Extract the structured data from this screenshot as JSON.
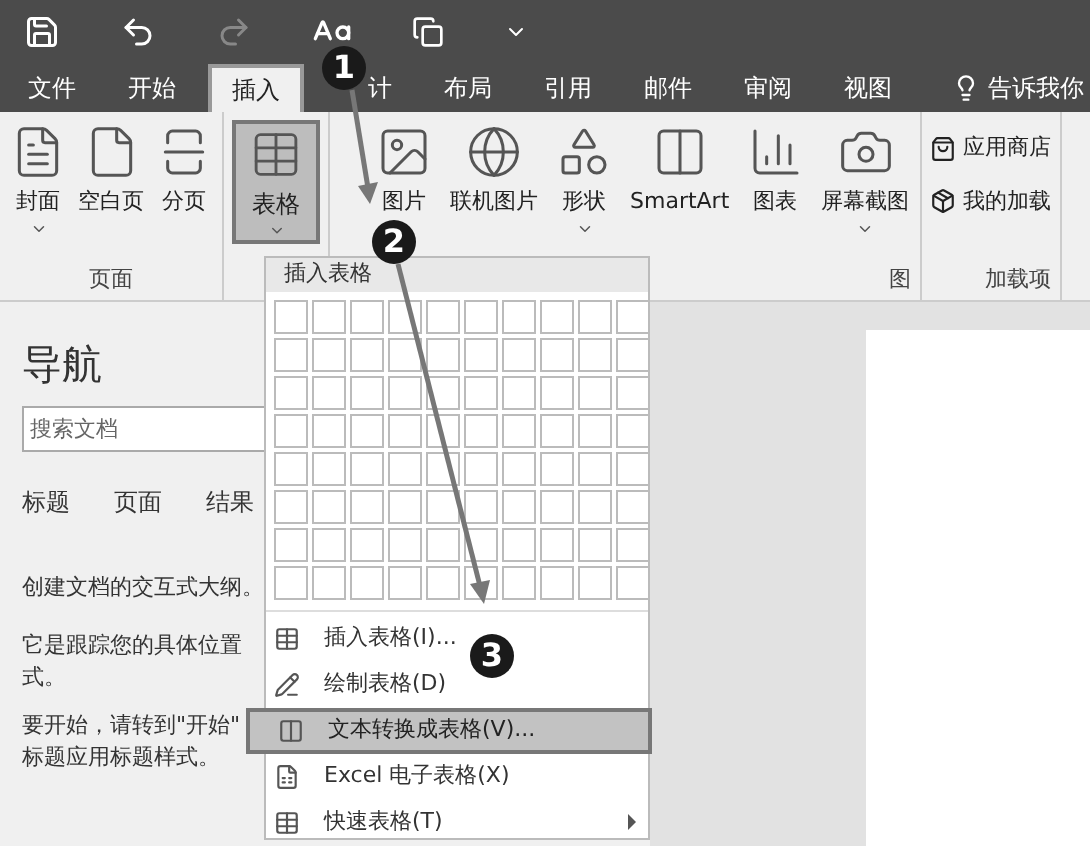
{
  "tabs": [
    {
      "label": "文件",
      "selected": false
    },
    {
      "label": "开始",
      "selected": false
    },
    {
      "label": "插入",
      "selected": true
    },
    {
      "label": "计",
      "selected": false
    },
    {
      "label": "布局",
      "selected": false
    },
    {
      "label": "引用",
      "selected": false
    },
    {
      "label": "邮件",
      "selected": false
    },
    {
      "label": "审阅",
      "selected": false
    },
    {
      "label": "视图",
      "selected": false
    }
  ],
  "tell_me": "告诉我你",
  "ribbon": {
    "groups": [
      {
        "label": "页面",
        "buttons": [
          {
            "label": "封面",
            "dropdown": true,
            "pressed": false
          },
          {
            "label": "空白页",
            "dropdown": false,
            "pressed": false
          },
          {
            "label": "分页",
            "dropdown": false,
            "pressed": false
          }
        ]
      },
      {
        "buttons": [
          {
            "label": "表格",
            "dropdown": true,
            "pressed": true
          }
        ]
      },
      {
        "label": "图",
        "buttons": [
          {
            "label": "图片",
            "dropdown": false,
            "pressed": false
          },
          {
            "label": "联机图片",
            "dropdown": false,
            "pressed": false
          },
          {
            "label": "形状",
            "dropdown": true,
            "pressed": false
          },
          {
            "label": "SmartArt",
            "dropdown": false,
            "pressed": false
          },
          {
            "label": "图表",
            "dropdown": false,
            "pressed": false
          },
          {
            "label": "屏幕截图",
            "dropdown": true,
            "pressed": false
          }
        ]
      },
      {
        "label": "加载项",
        "small_buttons": [
          "应用商店",
          "我的加载"
        ]
      }
    ]
  },
  "navigation": {
    "title": "导航",
    "search": {
      "placeholder": "搜索文档"
    },
    "tabs": [
      "标题",
      "页面",
      "结果"
    ],
    "paragraphs": [
      "创建文档的交互式大纲。",
      "它是跟踪您的具体位置",
      "式。",
      "要开始，请转到\"开始\"",
      "标题应用标题样式。"
    ]
  },
  "menu": {
    "title": "插入表格",
    "items": [
      {
        "label": "插入表格(I)...",
        "selected": false,
        "submenu": false
      },
      {
        "label": "绘制表格(D)",
        "selected": false,
        "submenu": false
      },
      {
        "label": "文本转换成表格(V)...",
        "selected": true,
        "submenu": false
      },
      {
        "label": "Excel 电子表格(X)",
        "selected": false,
        "submenu": false
      },
      {
        "label": "快速表格(T)",
        "selected": false,
        "submenu": true
      }
    ]
  },
  "callouts": [
    "1",
    "2",
    "3"
  ]
}
